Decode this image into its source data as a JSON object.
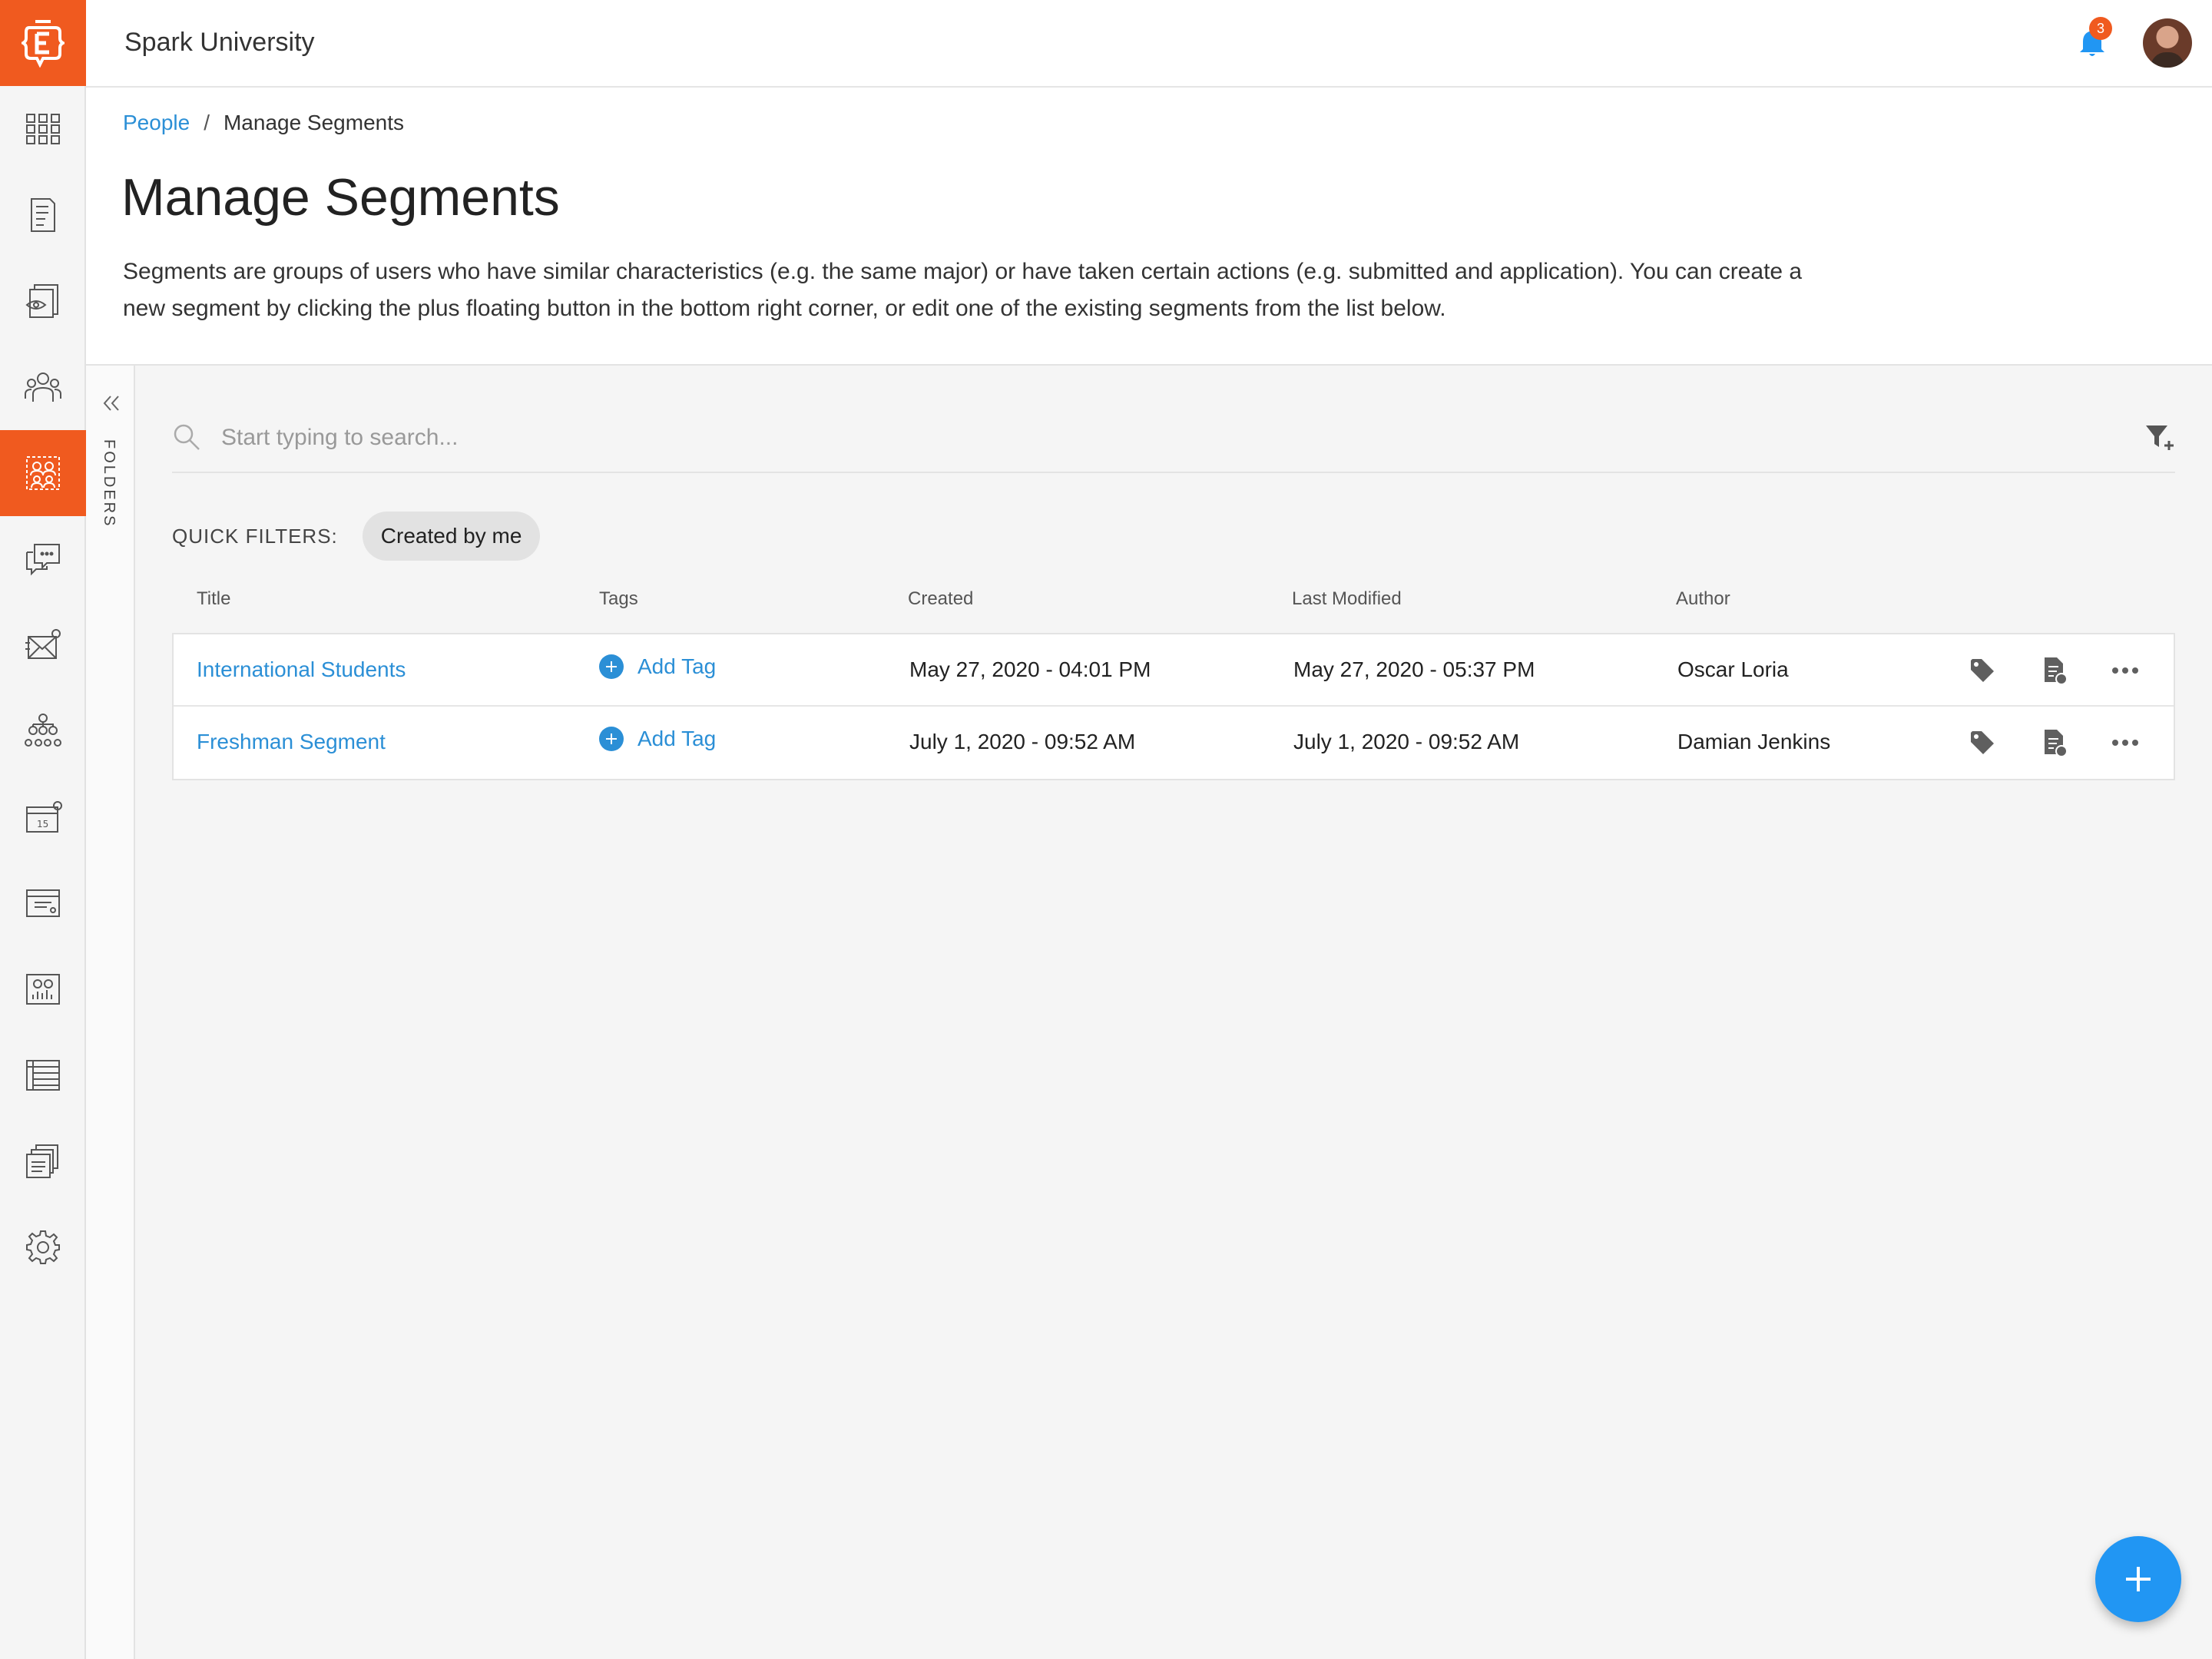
{
  "app": {
    "title": "Spark University",
    "notification_count": "3"
  },
  "nav": {
    "items": [
      {
        "icon": "dashboard-grid-icon"
      },
      {
        "icon": "forms-icon"
      },
      {
        "icon": "review-icon"
      },
      {
        "icon": "people-icon"
      },
      {
        "icon": "segments-icon",
        "active": true
      },
      {
        "icon": "messages-icon"
      },
      {
        "icon": "email-icon"
      },
      {
        "icon": "org-chart-icon"
      },
      {
        "icon": "calendar-icon"
      },
      {
        "icon": "payments-icon"
      },
      {
        "icon": "reports-icon"
      },
      {
        "icon": "table-icon"
      },
      {
        "icon": "documents-icon"
      },
      {
        "icon": "settings-gear-icon"
      }
    ]
  },
  "breadcrumb": {
    "parent": "People",
    "separator": "/",
    "current": "Manage Segments"
  },
  "page": {
    "title": "Manage Segments",
    "description": "Segments are groups of users who have similar characteristics (e.g. the same major) or have taken certain actions (e.g. submitted and application). You can create a new segment by clicking the plus floating button in the bottom right corner, or edit one of the existing segments from the list below."
  },
  "folders": {
    "label": "FOLDERS"
  },
  "search": {
    "placeholder": "Start typing to search..."
  },
  "quick_filters": {
    "label": "QUICK FILTERS:",
    "chips": [
      "Created by me"
    ]
  },
  "table": {
    "headers": [
      "Title",
      "Tags",
      "Created",
      "Last Modified",
      "Author"
    ],
    "rows": [
      {
        "title": "International Students",
        "tag_action": "Add Tag",
        "created": "May 27, 2020 - 04:01 PM",
        "modified": "May 27, 2020 - 05:37 PM",
        "author": "Oscar Loria"
      },
      {
        "title": "Freshman Segment",
        "tag_action": "Add Tag",
        "created": "July 1, 2020 - 09:52 AM",
        "modified": "July 1, 2020 - 09:52 AM",
        "author": "Damian Jenkins"
      }
    ]
  },
  "colors": {
    "brand": "#f05a1f",
    "link": "#2b8fd6",
    "fab": "#2196f3"
  }
}
